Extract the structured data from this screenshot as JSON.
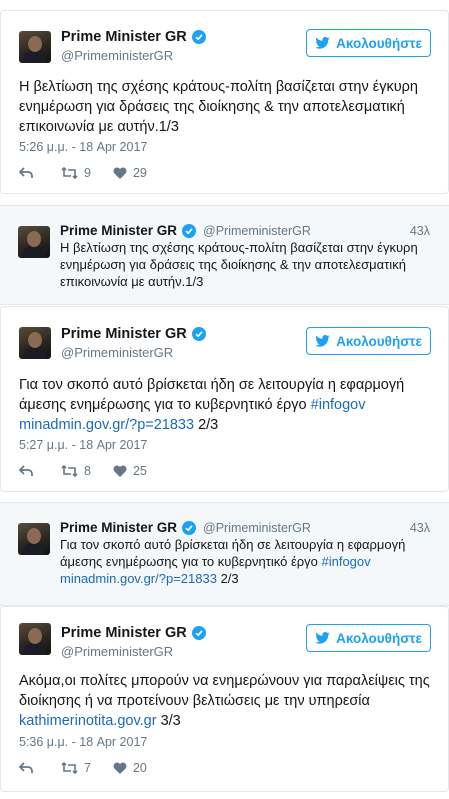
{
  "account": {
    "name": "Prime Minister GR",
    "handle": "@PrimeministerGR",
    "follow_label": "Ακολουθήστε"
  },
  "tweets": [
    {
      "text": "Η βελτίωση της σχέσης κράτους-πολίτη βασίζεται στην έγκυρη ενημέρωση για δράσεις της διοίκησης & την αποτελεσματική επικοινωνία με αυτήν.1/3",
      "time": "5:26 μ.μ. - 18 Apr 2017",
      "retweets": "9",
      "likes": "29"
    },
    {
      "text_before": "Για τον σκοπό αυτό βρίσκεται ήδη σε λειτουργία η εφαρμογή άμεσης ενημέρωσης για το κυβερνητικό έργο ",
      "hashtag": "#infogov",
      "link": "minadmin.gov.gr/?p=21833",
      "suffix": " 2/3",
      "time": "5:27 μ.μ. - 18 Apr 2017",
      "retweets": "8",
      "likes": "25"
    },
    {
      "text_before": "Ακόμα,οι πολίτες μπορούν να ενημερώνουν για παραλείψεις της διοίκησης ή να προτείνουν βελτιώσεις με την υπηρεσία ",
      "link": "kathimerinotita.gov.gr",
      "suffix": " 3/3",
      "time": "5:36 μ.μ. - 18 Apr 2017",
      "retweets": "7",
      "likes": "20"
    }
  ],
  "quotes": [
    {
      "age": "43λ",
      "text": "Η βελτίωση της σχέσης κράτους-πολίτη βασίζεται στην έγκυρη ενημέρωση για δράσεις της διοίκησης & την αποτελεσματική επικοινωνία με αυτήν.1/3"
    },
    {
      "age": "43λ",
      "text_before": "Για τον σκοπό αυτό βρίσκεται ήδη σε λειτουργία η εφαρμογή άμεσης ενημέρωσης για το κυβερνητικό έργο ",
      "hashtag": "#infogov",
      "link": "minadmin.gov.gr/?p=21833",
      "suffix": " 2/3"
    }
  ],
  "icons": {
    "verified": "verified-badge-icon",
    "follow": "twitter-bird-icon",
    "reply": "reply-icon",
    "retweet": "retweet-icon",
    "like": "heart-icon"
  },
  "colors": {
    "accent": "#1da1f2",
    "link": "#1b6ab8",
    "muted": "#657786",
    "quote_bg": "#f5f8fa"
  }
}
